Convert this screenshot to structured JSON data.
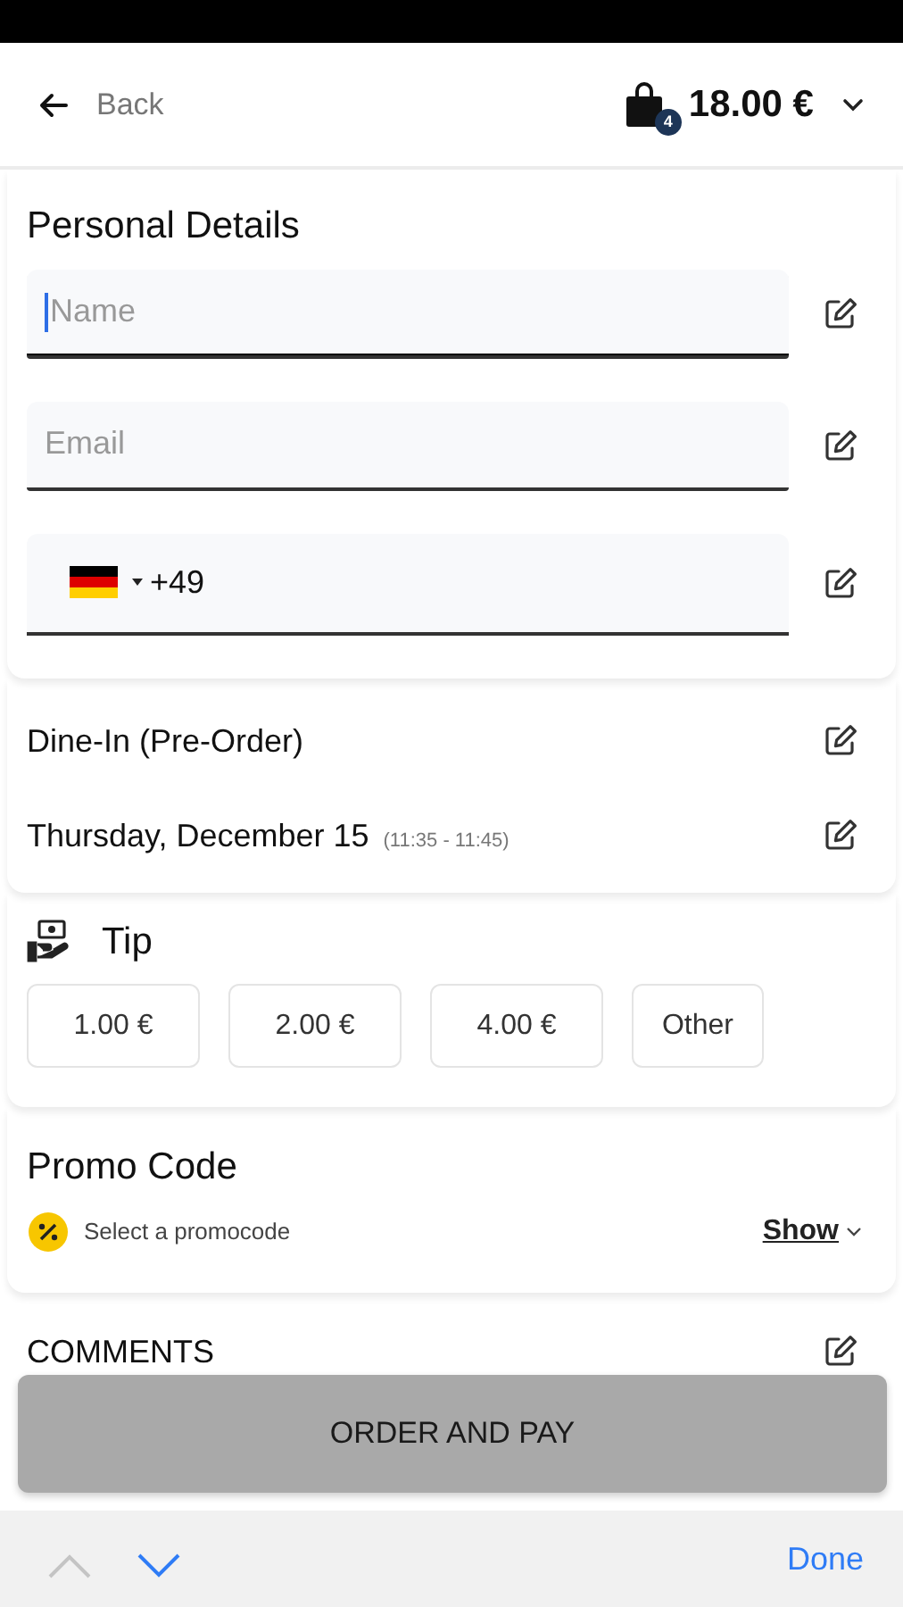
{
  "header": {
    "back_label": "Back",
    "cart_count": "4",
    "total": "18.00 €"
  },
  "personal_details": {
    "title": "Personal Details",
    "fields": [
      {
        "kind": "text",
        "placeholder": "Name",
        "focused": true
      },
      {
        "kind": "text",
        "placeholder": "Email",
        "focused": false
      },
      {
        "kind": "phone",
        "value": "+49",
        "focused": false
      }
    ]
  },
  "order_type": {
    "mode": "Dine-In (Pre-Order)",
    "date": "Thursday, December 15",
    "time": "(11:35 - 11:45)"
  },
  "tip": {
    "title": "Tip",
    "options": [
      {
        "label": "1.00 €",
        "selected": false
      },
      {
        "label": "2.00 €",
        "selected": false
      },
      {
        "label": "4.00 €",
        "selected": false
      },
      {
        "label": "Other",
        "selected": false
      }
    ]
  },
  "promo": {
    "title": "Promo Code",
    "prompt": "Select a promocode",
    "toggle": "Show"
  },
  "comments": {
    "title": "COMMENTS"
  },
  "order_button": "ORDER AND PAY",
  "keyboard_toolbar": {
    "previous_disabled": true,
    "next_disabled": false,
    "done": "Done"
  }
}
